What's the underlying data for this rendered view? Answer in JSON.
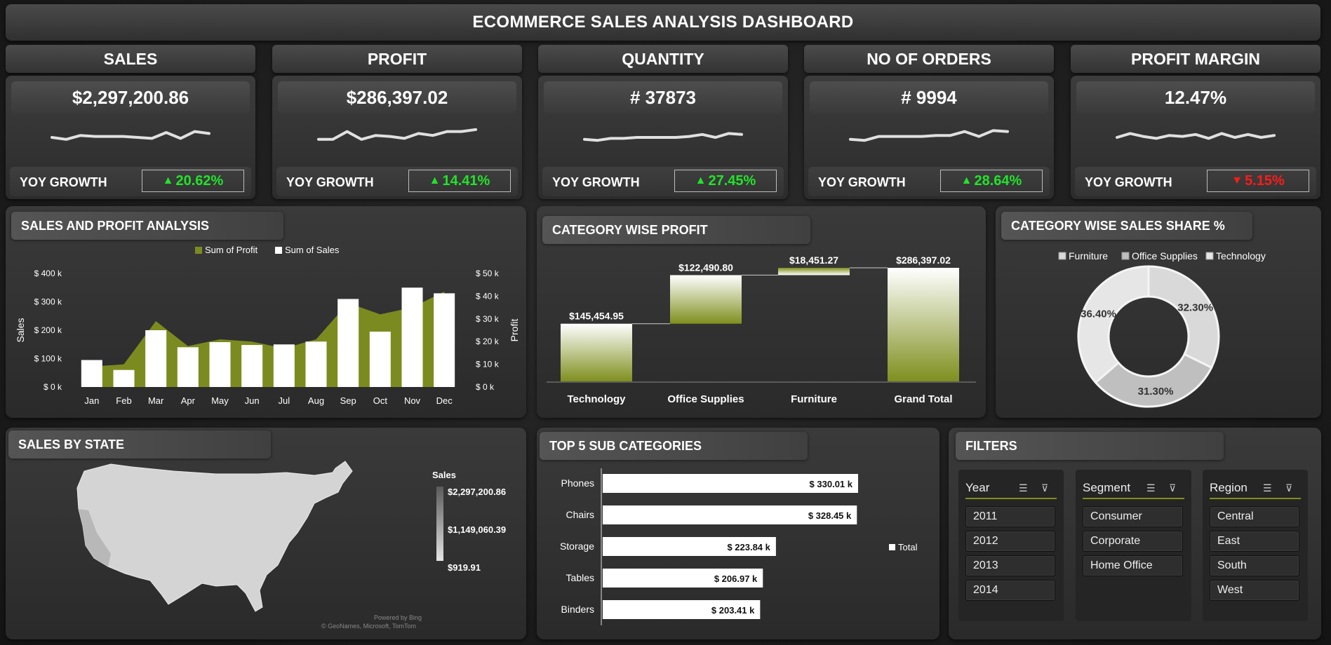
{
  "title": "ECOMMERCE SALES ANALYSIS DASHBOARD",
  "kpis": [
    {
      "label": "SALES",
      "value": "$2,297,200.86",
      "yoy_label": "YOY GROWTH",
      "yoy": "20.62%",
      "trend": "up",
      "spark": [
        0.5,
        0.6,
        0.4,
        0.45,
        0.45,
        0.45,
        0.5,
        0.55,
        0.25,
        0.55,
        0.2,
        0.3
      ]
    },
    {
      "label": "PROFIT",
      "value": "$286,397.02",
      "yoy_label": "YOY GROWTH",
      "yoy": "14.41%",
      "trend": "up",
      "spark": [
        0.6,
        0.6,
        0.2,
        0.6,
        0.4,
        0.45,
        0.55,
        0.3,
        0.4,
        0.2,
        0.2,
        0.1
      ]
    },
    {
      "label": "QUANTITY",
      "value": "# 37873",
      "yoy_label": "YOY GROWTH",
      "yoy": "27.45%",
      "trend": "up",
      "spark": [
        0.6,
        0.65,
        0.55,
        0.55,
        0.5,
        0.5,
        0.5,
        0.5,
        0.45,
        0.35,
        0.5,
        0.3,
        0.35
      ]
    },
    {
      "label": "NO OF ORDERS",
      "value": "# 9994",
      "yoy_label": "YOY GROWTH",
      "yoy": "28.64%",
      "trend": "up",
      "spark": [
        0.6,
        0.65,
        0.45,
        0.45,
        0.45,
        0.45,
        0.4,
        0.4,
        0.2,
        0.45,
        0.15,
        0.2
      ]
    },
    {
      "label": "PROFIT MARGIN",
      "value": "12.47%",
      "yoy_label": "YOY GROWTH",
      "yoy": "5.15%",
      "trend": "down",
      "spark": [
        0.5,
        0.3,
        0.45,
        0.55,
        0.4,
        0.45,
        0.35,
        0.55,
        0.3,
        0.5,
        0.35,
        0.5,
        0.4
      ]
    }
  ],
  "sections": {
    "sales_profit": "SALES AND PROFIT ANALYSIS",
    "category_profit": "CATEGORY WISE PROFIT",
    "category_share": "CATEGORY WISE SALES SHARE %",
    "sales_state": "SALES BY STATE",
    "top5": "TOP 5 SUB CATEGORIES",
    "filters": "FILTERS"
  },
  "chart_data": [
    {
      "type": "bar",
      "title": "",
      "categories": [
        "Jan",
        "Feb",
        "Mar",
        "Apr",
        "May",
        "Jun",
        "Jul",
        "Aug",
        "Sep",
        "Oct",
        "Nov",
        "Dec"
      ],
      "series": [
        {
          "name": "Sum of Profit",
          "type": "area",
          "axis": "right",
          "color": "#7c8b1f",
          "values": [
            9000,
            10000,
            29000,
            18000,
            21000,
            20000,
            17000,
            21000,
            37000,
            32000,
            35000,
            42000
          ]
        },
        {
          "name": "Sum of Sales",
          "type": "bar",
          "axis": "left",
          "color": "#ffffff",
          "values": [
            95000,
            60000,
            200000,
            140000,
            158000,
            148000,
            150000,
            160000,
            310000,
            195000,
            350000,
            330000
          ]
        }
      ],
      "ylabel": "Sales",
      "y2label": "Profit",
      "ylim": [
        0,
        400000
      ],
      "y2lim": [
        0,
        50000
      ],
      "yticks": [
        "$ 0 k",
        "$ 100 k",
        "$ 200 k",
        "$ 300 k",
        "$ 400 k"
      ],
      "y2ticks": [
        "$ 0 k",
        "$ 10 k",
        "$ 20 k",
        "$ 30 k",
        "$ 40 k",
        "$ 50 k"
      ],
      "legend": "top"
    },
    {
      "type": "waterfall",
      "title": "",
      "categories": [
        "Technology",
        "Office Supplies",
        "Furniture",
        "Grand Total"
      ],
      "values": [
        145454.95,
        122490.8,
        18451.27,
        286397.02
      ],
      "labels": [
        "$145,454.95",
        "$122,490.80",
        "$18,451.27",
        "$286,397.02"
      ]
    },
    {
      "type": "pie",
      "title": "",
      "categories": [
        "Furniture",
        "Office Supplies",
        "Technology"
      ],
      "values": [
        32.3,
        31.3,
        36.4
      ],
      "labels": [
        "32.30%",
        "31.30%",
        "36.40%"
      ],
      "colors": [
        "#d9d9d9",
        "#bfbfbf",
        "#e6e6e6"
      ],
      "legend": "top"
    },
    {
      "type": "bar",
      "orientation": "horizontal",
      "title": "",
      "categories": [
        "Phones",
        "Chairs",
        "Storage",
        "Tables",
        "Binders"
      ],
      "values": [
        330.01,
        328.45,
        223.84,
        206.97,
        203.41
      ],
      "labels": [
        "$ 330.01 k",
        "$ 328.45 k",
        "$ 223.84 k",
        "$ 206.97 k",
        "$ 203.41 k"
      ],
      "series_name": "Total",
      "legend": "right"
    }
  ],
  "map": {
    "legend_title": "Sales",
    "max": "$2,297,200.86",
    "mid": "$1,149,060.39",
    "min": "$919.91",
    "credit1": "Powered by Bing",
    "credit2": "© GeoNames, Microsoft, TomTom"
  },
  "filters": [
    {
      "name": "Year",
      "items": [
        "2011",
        "2012",
        "2013",
        "2014"
      ]
    },
    {
      "name": "Segment",
      "items": [
        "Consumer",
        "Corporate",
        "Home Office"
      ]
    },
    {
      "name": "Region",
      "items": [
        "Central",
        "East",
        "South",
        "West"
      ]
    }
  ]
}
